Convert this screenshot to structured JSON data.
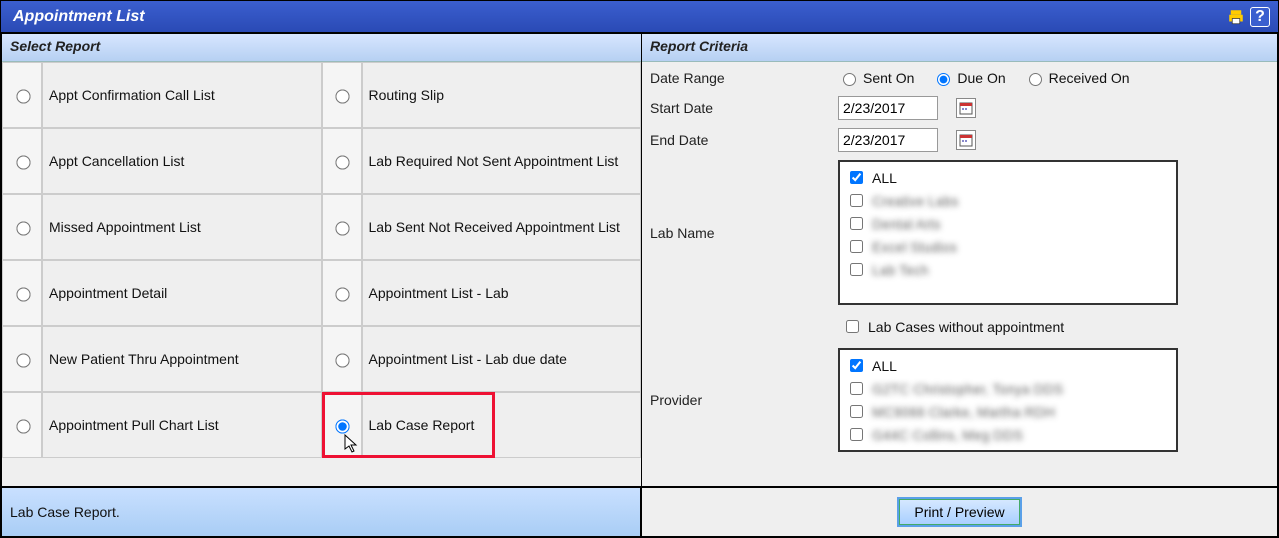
{
  "window": {
    "title": "Appointment List"
  },
  "leftPanel": {
    "header": "Select Report",
    "reports": [
      {
        "label": "Appt Confirmation Call List"
      },
      {
        "label": "Routing Slip"
      },
      {
        "label": "Appt Cancellation List"
      },
      {
        "label": "Lab Required Not Sent Appointment List"
      },
      {
        "label": "Missed Appointment List"
      },
      {
        "label": "Lab Sent Not Received Appointment List"
      },
      {
        "label": "Appointment Detail"
      },
      {
        "label": "Appointment List - Lab"
      },
      {
        "label": "New Patient Thru Appointment"
      },
      {
        "label": "Appointment List - Lab due date"
      },
      {
        "label": "Appointment Pull Chart List"
      },
      {
        "label": "Lab Case Report",
        "selected": true
      }
    ]
  },
  "rightPanel": {
    "header": "Report Criteria",
    "dateRange": {
      "label": "Date Range",
      "options": [
        "Sent On",
        "Due On",
        "Received On"
      ],
      "selected": "Due On"
    },
    "startDate": {
      "label": "Start Date",
      "value": "2/23/2017"
    },
    "endDate": {
      "label": "End Date",
      "value": "2/23/2017"
    },
    "labName": {
      "label": "Lab Name",
      "all": "ALL",
      "items": [
        "Creative Labs",
        "Dental Arts",
        "Excel Studios",
        "Lab Tech"
      ]
    },
    "labCasesWithout": "Lab Cases without appointment",
    "provider": {
      "label": "Provider",
      "all": "ALL",
      "items": [
        "G2TC   Christopher, Tonya DDS",
        "MC9066  Clarke, Martha RDH",
        "G44C   Collins, Meg DDS"
      ]
    }
  },
  "footer": {
    "status": "Lab Case Report.",
    "printButton": "Print / Preview"
  }
}
